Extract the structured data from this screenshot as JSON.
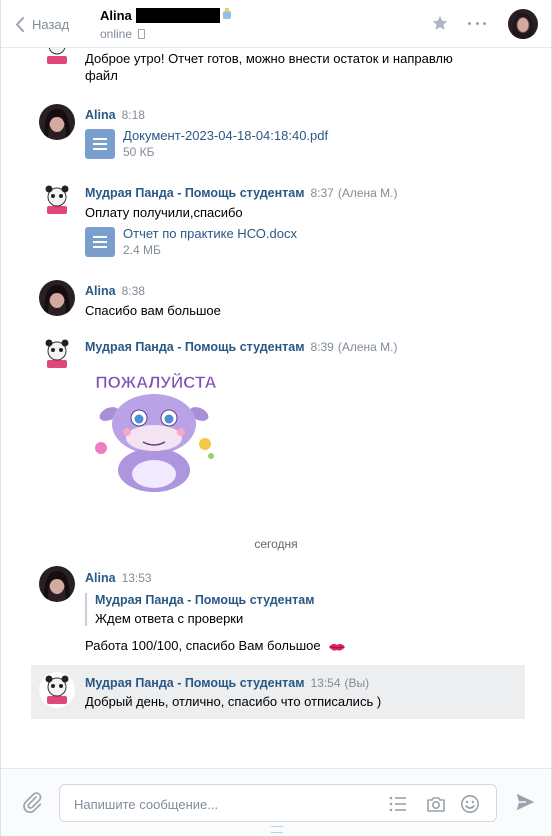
{
  "header": {
    "back_label": "Назад",
    "peer_name": "Alina",
    "peer_status": "online"
  },
  "messages": [
    {
      "text": "Доброе утро! Отчет готов, можно внести остаток и направлю файл"
    },
    {
      "author": "Alina",
      "time": "8:18",
      "doc_name": "Документ-2023-04-18-04:18:40.pdf",
      "doc_size": "50 КБ"
    },
    {
      "author": "Мудрая Панда - Помощь студентам",
      "time": "8:37",
      "sub": "(Алена М.)",
      "text": "Оплату получили,спасибо",
      "doc_name": "Отчет по практике НСО.docx",
      "doc_size": "2.4 МБ"
    },
    {
      "author": "Alina",
      "time": "8:38",
      "text": "Спасибо вам большое"
    },
    {
      "author": "Мудрая Панда - Помощь студентам",
      "time": "8:39",
      "sub": "(Алена М.)",
      "sticker_text": "ПОЖАЛУЙСТА"
    },
    {
      "author": "Alina",
      "time": "13:53",
      "quote_author": "Мудрая Панда - Помощь студентам",
      "quote_text": "Ждем ответа с проверки",
      "text": "Работа 100/100, спасибо Вам большое"
    },
    {
      "author": "Мудрая Панда - Помощь студентам",
      "time": "13:54",
      "sub": "(Вы)",
      "text": "Добрый день, отлично, спасибо что отписались )"
    }
  ],
  "date_separator": "сегодня",
  "composer": {
    "placeholder": "Напишите сообщение..."
  },
  "colors": {
    "link": "#2a5885",
    "muted": "#818c99",
    "doc_icon": "#7a9fcc",
    "highlight_bg": "#edeef0"
  }
}
